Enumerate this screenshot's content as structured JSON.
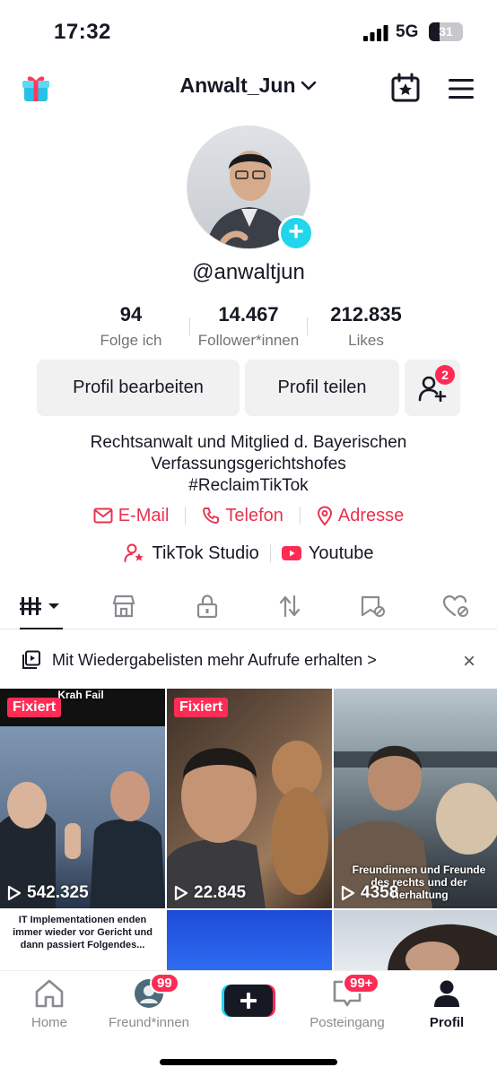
{
  "status_bar": {
    "time": "17:32",
    "network": "5G",
    "battery": "31",
    "battery_level": 0.31
  },
  "header": {
    "username": "Anwalt_Jun",
    "gift_icon": "gift-box-icon",
    "calendar_icon": "calendar-star-icon",
    "menu_icon": "hamburger-menu-icon"
  },
  "profile": {
    "handle": "@anwaltjun"
  },
  "stats": [
    {
      "value": "94",
      "label": "Folge ich"
    },
    {
      "value": "14.467",
      "label": "Follower*innen"
    },
    {
      "value": "212.835",
      "label": "Likes"
    }
  ],
  "actions": {
    "edit": "Profil bearbeiten",
    "share": "Profil teilen",
    "add_friends_count": "2"
  },
  "bio": {
    "line1": "Rechtsanwalt und Mitglied d. Bayerischen",
    "line2": "Verfassungsgerichtshofes",
    "line3": "#ReclaimTikTok"
  },
  "contacts": {
    "email": "E-Mail",
    "phone": "Telefon",
    "address": "Adresse"
  },
  "links": {
    "studio": "TikTok Studio",
    "youtube": "Youtube"
  },
  "promo": {
    "text": "Mit Wiedergabelisten mehr Aufrufe erhalten",
    "chevron": ">",
    "close": "×"
  },
  "videos": [
    {
      "pinned": "Fixiert",
      "views": "542.325",
      "overlay": "Krah Fail"
    },
    {
      "pinned": "Fixiert",
      "views": "22.845"
    },
    {
      "views": "4358",
      "overlay": "Freundinnen und Freunde des rechts und der Tierhaltung"
    },
    {
      "caption": "IT Implementationen enden immer wieder vor Gericht und dann passiert Folgendes..."
    },
    {},
    {}
  ],
  "colors": {
    "accent": "#fe2c55",
    "cyan": "#20d5ec",
    "text": "#161823",
    "muted": "#737373",
    "button_bg": "#f1f1f2"
  },
  "tabbar": {
    "home": "Home",
    "friends": "Freund*innen",
    "friends_badge": "99",
    "inbox": "Posteingang",
    "inbox_badge": "99+",
    "profile": "Profil",
    "create": "+"
  }
}
